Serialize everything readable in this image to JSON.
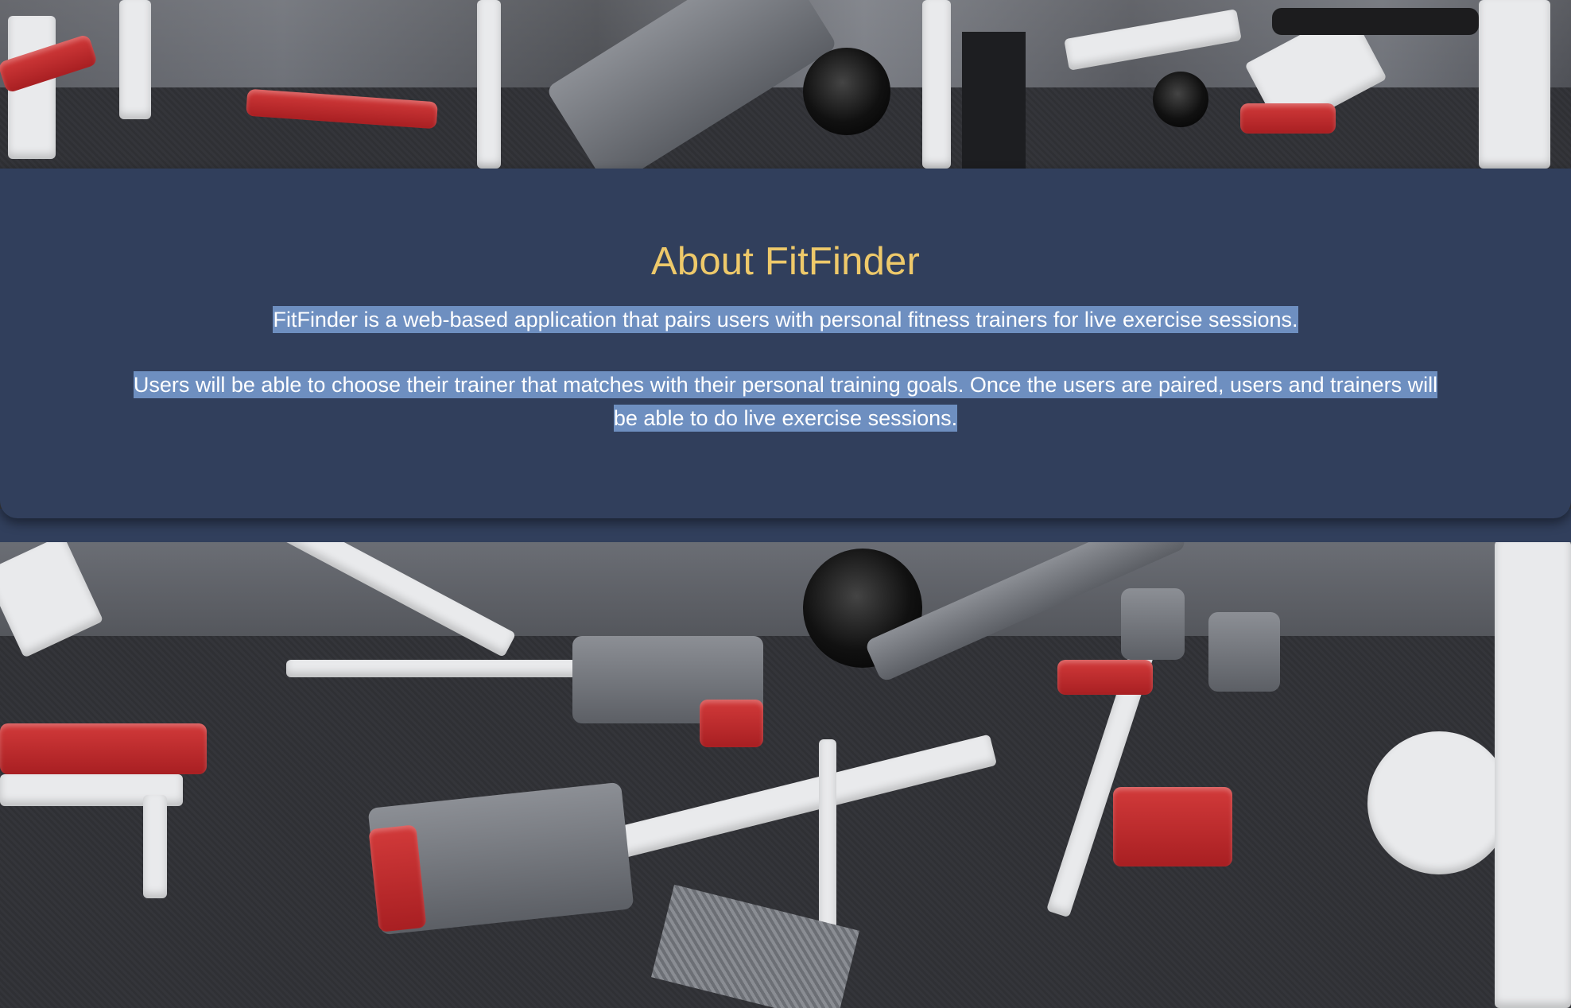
{
  "about": {
    "title": "About FitFinder",
    "paragraph_1": "FitFinder is a web-based application that pairs users with personal fitness trainers for live exercise sessions.",
    "paragraph_2": "Users will be able to choose their trainer that matches with their personal training goals. Once the users are paired, users and trainers will be able to do live exercise sessions."
  },
  "background": {
    "image_subject": "gym-equipment-photo"
  },
  "colors": {
    "panel_background": "#313f5c",
    "title_color": "#eec96a",
    "text_color": "#ffffff",
    "selection_highlight": "#6e8fc0"
  }
}
